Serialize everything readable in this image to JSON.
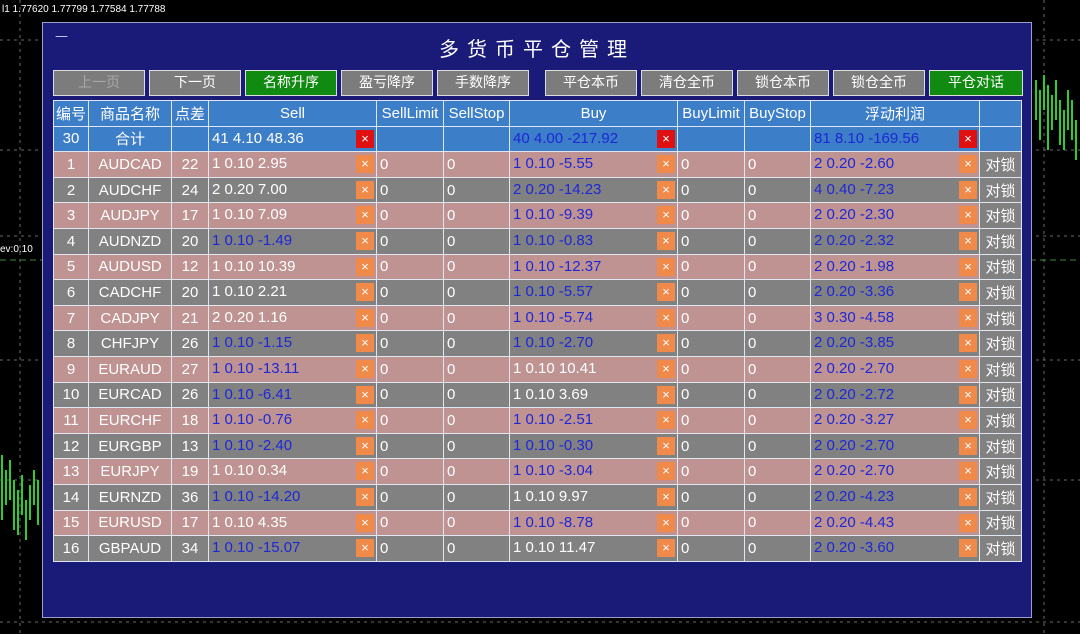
{
  "chart": {
    "top_info": "l1  1.77620 1.77799 1.77584 1.77788",
    "side_label": "ev:0.10"
  },
  "panel": {
    "title": "多货币平仓管理",
    "minimize_symbol": "—"
  },
  "toolbar": {
    "prev_page": "上一页",
    "next_page": "下一页",
    "sort_name_asc": "名称升序",
    "sort_pnl_desc": "盈亏降序",
    "sort_lots_desc": "手数降序",
    "close_this": "平仓本币",
    "close_all": "清仓全币",
    "lock_this": "锁仓本币",
    "lock_all": "锁仓全币",
    "close_hedge": "平仓对话"
  },
  "headers": [
    "编号",
    "商品名称",
    "点差",
    "Sell",
    "SellLimit",
    "SellStop",
    "Buy",
    "BuyLimit",
    "BuyStop",
    "浮动利润",
    ""
  ],
  "summary": {
    "id": "30",
    "name": "合计",
    "spread": "",
    "sell": "41  4.10  48.36",
    "sell_limit": "",
    "sell_stop": "",
    "buy": "40  4.00  -217.92",
    "buy_limit": "",
    "buy_stop": "",
    "profit": "81  8.10  -169.56"
  },
  "close_symbol": "×",
  "lock_label": "对锁",
  "rows": [
    {
      "id": "1",
      "name": "AUDCAD",
      "spread": "22",
      "sell": "1  0.10  2.95",
      "sell_blue": false,
      "sl": "0",
      "ss": "0",
      "buy": "1  0.10  -5.55",
      "buy_blue": true,
      "bl": "0",
      "bs": "0",
      "profit": "2  0.20  -2.60"
    },
    {
      "id": "2",
      "name": "AUDCHF",
      "spread": "24",
      "sell": "2  0.20  7.00",
      "sell_blue": false,
      "sl": "0",
      "ss": "0",
      "buy": "2  0.20  -14.23",
      "buy_blue": true,
      "bl": "0",
      "bs": "0",
      "profit": "4  0.40  -7.23"
    },
    {
      "id": "3",
      "name": "AUDJPY",
      "spread": "17",
      "sell": "1  0.10  7.09",
      "sell_blue": false,
      "sl": "0",
      "ss": "0",
      "buy": "1  0.10  -9.39",
      "buy_blue": true,
      "bl": "0",
      "bs": "0",
      "profit": "2  0.20  -2.30"
    },
    {
      "id": "4",
      "name": "AUDNZD",
      "spread": "20",
      "sell": "1  0.10  -1.49",
      "sell_blue": true,
      "sl": "0",
      "ss": "0",
      "buy": "1  0.10  -0.83",
      "buy_blue": true,
      "bl": "0",
      "bs": "0",
      "profit": "2  0.20  -2.32"
    },
    {
      "id": "5",
      "name": "AUDUSD",
      "spread": "12",
      "sell": "1  0.10  10.39",
      "sell_blue": false,
      "sl": "0",
      "ss": "0",
      "buy": "1  0.10  -12.37",
      "buy_blue": true,
      "bl": "0",
      "bs": "0",
      "profit": "2  0.20  -1.98"
    },
    {
      "id": "6",
      "name": "CADCHF",
      "spread": "20",
      "sell": "1  0.10  2.21",
      "sell_blue": false,
      "sl": "0",
      "ss": "0",
      "buy": "1  0.10  -5.57",
      "buy_blue": true,
      "bl": "0",
      "bs": "0",
      "profit": "2  0.20  -3.36"
    },
    {
      "id": "7",
      "name": "CADJPY",
      "spread": "21",
      "sell": "2  0.20  1.16",
      "sell_blue": false,
      "sl": "0",
      "ss": "0",
      "buy": "1  0.10  -5.74",
      "buy_blue": true,
      "bl": "0",
      "bs": "0",
      "profit": "3  0.30  -4.58"
    },
    {
      "id": "8",
      "name": "CHFJPY",
      "spread": "26",
      "sell": "1  0.10  -1.15",
      "sell_blue": true,
      "sl": "0",
      "ss": "0",
      "buy": "1  0.10  -2.70",
      "buy_blue": true,
      "bl": "0",
      "bs": "0",
      "profit": "2  0.20  -3.85"
    },
    {
      "id": "9",
      "name": "EURAUD",
      "spread": "27",
      "sell": "1  0.10  -13.11",
      "sell_blue": true,
      "sl": "0",
      "ss": "0",
      "buy": "1  0.10  10.41",
      "buy_blue": false,
      "bl": "0",
      "bs": "0",
      "profit": "2  0.20  -2.70"
    },
    {
      "id": "10",
      "name": "EURCAD",
      "spread": "26",
      "sell": "1  0.10  -6.41",
      "sell_blue": true,
      "sl": "0",
      "ss": "0",
      "buy": "1  0.10  3.69",
      "buy_blue": false,
      "bl": "0",
      "bs": "0",
      "profit": "2  0.20  -2.72"
    },
    {
      "id": "11",
      "name": "EURCHF",
      "spread": "18",
      "sell": "1  0.10  -0.76",
      "sell_blue": true,
      "sl": "0",
      "ss": "0",
      "buy": "1  0.10  -2.51",
      "buy_blue": true,
      "bl": "0",
      "bs": "0",
      "profit": "2  0.20  -3.27"
    },
    {
      "id": "12",
      "name": "EURGBP",
      "spread": "13",
      "sell": "1  0.10  -2.40",
      "sell_blue": true,
      "sl": "0",
      "ss": "0",
      "buy": "1  0.10  -0.30",
      "buy_blue": true,
      "bl": "0",
      "bs": "0",
      "profit": "2  0.20  -2.70"
    },
    {
      "id": "13",
      "name": "EURJPY",
      "spread": "19",
      "sell": "1  0.10  0.34",
      "sell_blue": false,
      "sl": "0",
      "ss": "0",
      "buy": "1  0.10  -3.04",
      "buy_blue": true,
      "bl": "0",
      "bs": "0",
      "profit": "2  0.20  -2.70"
    },
    {
      "id": "14",
      "name": "EURNZD",
      "spread": "36",
      "sell": "1  0.10  -14.20",
      "sell_blue": true,
      "sl": "0",
      "ss": "0",
      "buy": "1  0.10  9.97",
      "buy_blue": false,
      "bl": "0",
      "bs": "0",
      "profit": "2  0.20  -4.23"
    },
    {
      "id": "15",
      "name": "EURUSD",
      "spread": "17",
      "sell": "1  0.10  4.35",
      "sell_blue": false,
      "sl": "0",
      "ss": "0",
      "buy": "1  0.10  -8.78",
      "buy_blue": true,
      "bl": "0",
      "bs": "0",
      "profit": "2  0.20  -4.43"
    },
    {
      "id": "16",
      "name": "GBPAUD",
      "spread": "34",
      "sell": "1  0.10  -15.07",
      "sell_blue": true,
      "sl": "0",
      "ss": "0",
      "buy": "1  0.10  11.47",
      "buy_blue": false,
      "bl": "0",
      "bs": "0",
      "profit": "2  0.20  -3.60"
    }
  ],
  "colors": {
    "panel_bg": "#1a1a78",
    "header_bg": "#3c7ec8",
    "row_odd": "#c09393",
    "row_even": "#818181",
    "button_green": "#118a11",
    "button_gray": "#7c7c7c",
    "close_orange": "#f08a4a",
    "close_red": "#e01010",
    "negative_blue": "#1d27d6"
  }
}
